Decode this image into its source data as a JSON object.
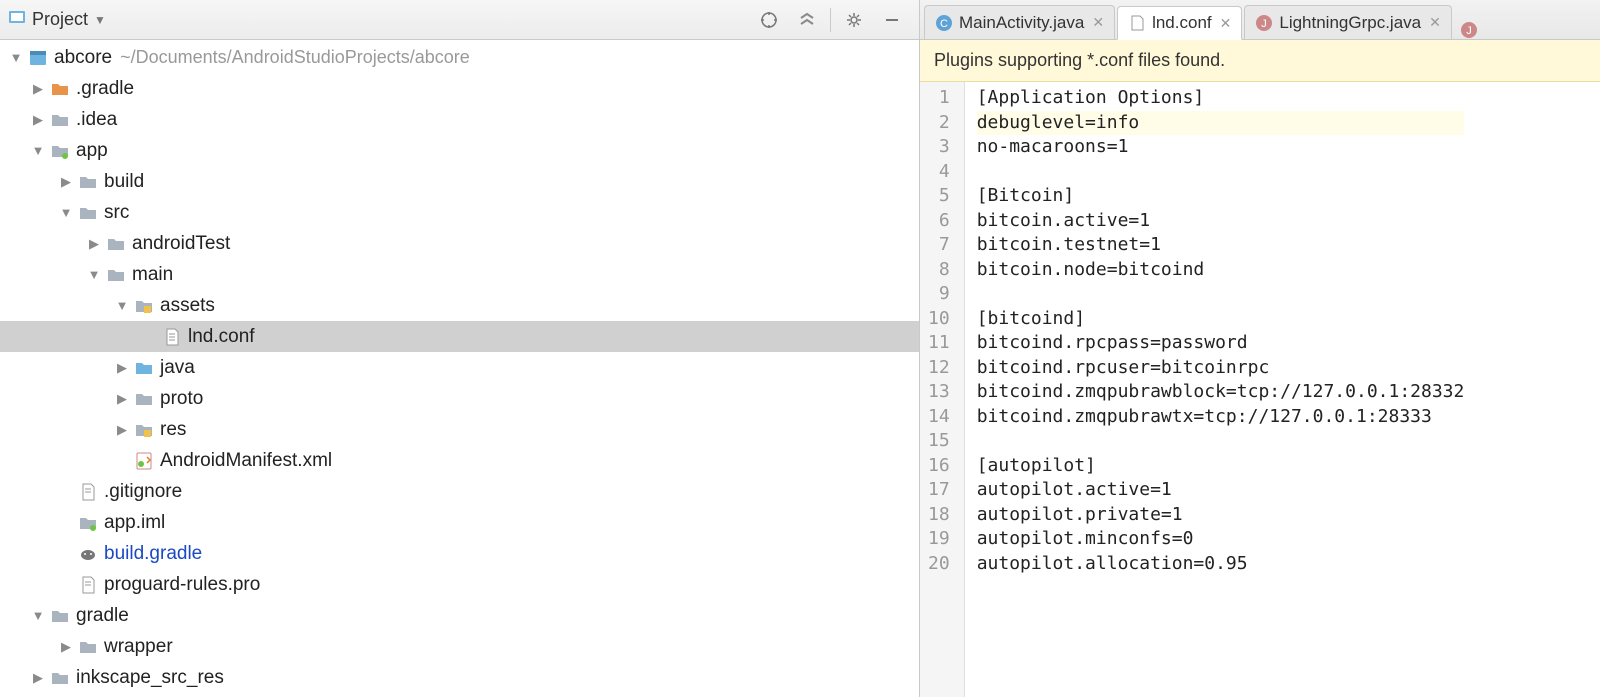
{
  "header": {
    "title": "Project"
  },
  "tree": {
    "root": {
      "name": "abcore",
      "path": "~/Documents/AndroidStudioProjects/abcore"
    },
    "items": [
      {
        "name": ".gradle"
      },
      {
        "name": ".idea"
      },
      {
        "name": "app"
      },
      {
        "name": "build"
      },
      {
        "name": "src"
      },
      {
        "name": "androidTest"
      },
      {
        "name": "main"
      },
      {
        "name": "assets"
      },
      {
        "name": "lnd.conf"
      },
      {
        "name": "java"
      },
      {
        "name": "proto"
      },
      {
        "name": "res"
      },
      {
        "name": "AndroidManifest.xml"
      },
      {
        "name": ".gitignore"
      },
      {
        "name": "app.iml"
      },
      {
        "name": "build.gradle"
      },
      {
        "name": "proguard-rules.pro"
      },
      {
        "name": "gradle"
      },
      {
        "name": "wrapper"
      },
      {
        "name": "inkscape_src_res"
      }
    ]
  },
  "tabs": [
    {
      "label": "MainActivity.java",
      "active": false
    },
    {
      "label": "lnd.conf",
      "active": true
    },
    {
      "label": "LightningGrpc.java",
      "active": false
    }
  ],
  "banner": "Plugins supporting *.conf files found.",
  "code_lines": [
    "[Application Options]",
    "debuglevel=info",
    "no-macaroons=1",
    "",
    "[Bitcoin]",
    "bitcoin.active=1",
    "bitcoin.testnet=1",
    "bitcoin.node=bitcoind",
    "",
    "[bitcoind]",
    "bitcoind.rpcpass=password",
    "bitcoind.rpcuser=bitcoinrpc",
    "bitcoind.zmqpubrawblock=tcp://127.0.0.1:28332",
    "bitcoind.zmqpubrawtx=tcp://127.0.0.1:28333",
    "",
    "[autopilot]",
    "autopilot.active=1",
    "autopilot.private=1",
    "autopilot.minconfs=0",
    "autopilot.allocation=0.95"
  ],
  "current_line": 2
}
